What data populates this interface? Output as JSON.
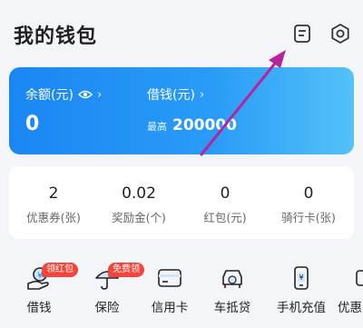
{
  "header": {
    "title": "我的钱包"
  },
  "balance_card": {
    "balance_label": "余额(元)",
    "balance_value": "0",
    "borrow_label": "借钱(元)",
    "borrow_prefix": "最高",
    "borrow_value": "200000"
  },
  "stats": [
    {
      "value": "2",
      "label": "优惠券(张)"
    },
    {
      "value": "0.02",
      "label": "奖励金(个)"
    },
    {
      "value": "0",
      "label": "红包(元)"
    },
    {
      "value": "0",
      "label": "骑行卡(张)"
    }
  ],
  "shortcuts": [
    {
      "label": "借钱",
      "badge": "领红包",
      "icon": "borrow-icon"
    },
    {
      "label": "保险",
      "badge": "免费领",
      "icon": "umbrella-icon"
    },
    {
      "label": "信用卡",
      "icon": "credit-card-icon"
    },
    {
      "label": "车抵贷",
      "icon": "car-loan-icon"
    },
    {
      "label": "手机充值",
      "icon": "phone-recharge-icon"
    },
    {
      "label": "优惠",
      "icon": "coupon-icon"
    }
  ],
  "colors": {
    "accent": "#1a86f3",
    "badge": "#f2463c",
    "annotation_arrow": "#b5249b"
  }
}
